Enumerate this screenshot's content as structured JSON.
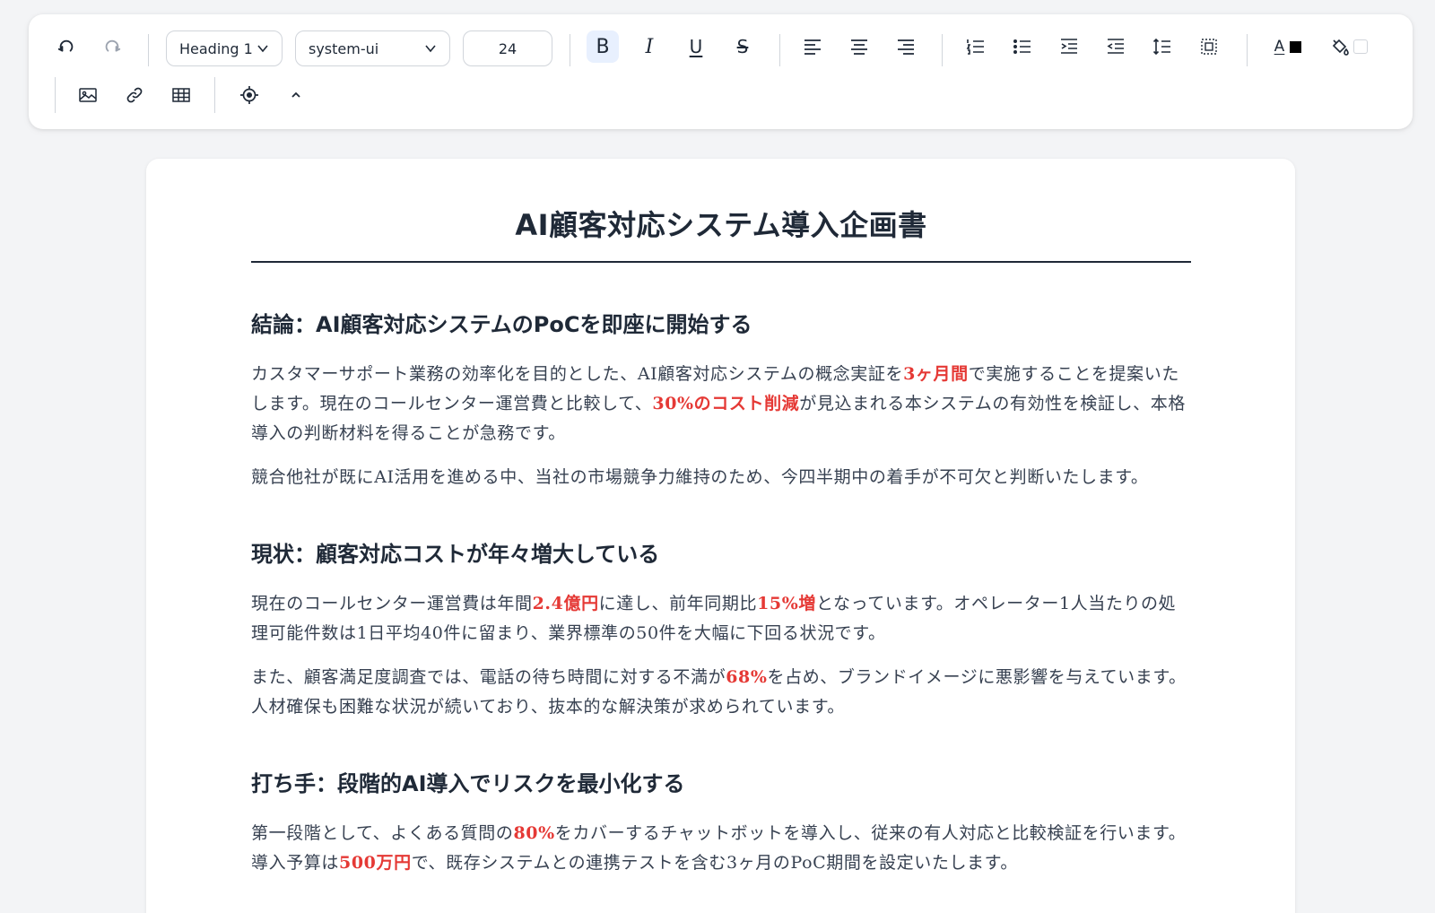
{
  "toolbar": {
    "block_style": "Heading 1",
    "font_family": "system-ui",
    "font_size": "24",
    "bold": "B",
    "italic": "I",
    "underline": "U",
    "strikethrough": "S",
    "font_color_letter": "A",
    "font_color": "#000000",
    "highlight_color": "#ffffff",
    "icons": [
      "undo-icon",
      "redo-icon",
      "align-left-icon",
      "align-center-icon",
      "align-right-icon",
      "ordered-list-icon",
      "bullet-list-icon",
      "indent-icon",
      "outdent-icon",
      "line-height-icon",
      "select-all-icon",
      "paint-bucket-icon",
      "image-icon",
      "link-icon",
      "table-icon",
      "target-icon",
      "chevron-up-icon"
    ]
  },
  "colors": {
    "accent": "#e53935",
    "active_bg": "#e8f0fe"
  },
  "document": {
    "title": "AI顧客対応システム導入企画書",
    "sections": [
      {
        "heading": "結論：AI顧客対応システムのPoCを即座に開始する",
        "paragraphs": [
          [
            {
              "t": "カスタマーサポート業務の効率化を目的とした、AI顧客対応システムの概念実証を"
            },
            {
              "t": "3ヶ月間",
              "hl": true
            },
            {
              "t": "で実施することを提案いたします。現在のコールセンター運営費と比較して、"
            },
            {
              "t": "30%のコスト削減",
              "hl": true
            },
            {
              "t": "が見込まれる本システムの有効性を検証し、本格導入の判断材料を得ることが急務です。"
            }
          ],
          [
            {
              "t": "競合他社が既にAI活用を進める中、当社の市場競争力維持のため、今四半期中の着手が不可欠と判断いたします。"
            }
          ]
        ]
      },
      {
        "heading": "現状：顧客対応コストが年々増大している",
        "paragraphs": [
          [
            {
              "t": "現在のコールセンター運営費は年間"
            },
            {
              "t": "2.4億円",
              "hl": true
            },
            {
              "t": "に達し、前年同期比"
            },
            {
              "t": "15%増",
              "hl": true
            },
            {
              "t": "となっています。オペレーター1人当たりの処理可能件数は1日平均40件に留まり、業界標準の50件を大幅に下回る状況です。"
            }
          ],
          [
            {
              "t": "また、顧客満足度調査では、電話の待ち時間に対する不満が"
            },
            {
              "t": "68%",
              "hl": true
            },
            {
              "t": "を占め、ブランドイメージに悪影響を与えています。人材確保も困難な状況が続いており、抜本的な解決策が求められています。"
            }
          ]
        ]
      },
      {
        "heading": "打ち手：段階的AI導入でリスクを最小化する",
        "paragraphs": [
          [
            {
              "t": "第一段階として、よくある質問の"
            },
            {
              "t": "80%",
              "hl": true
            },
            {
              "t": "をカバーするチャットボットを導入し、従来の有人対応と比較検証を行います。導入予算は"
            },
            {
              "t": "500万円",
              "hl": true
            },
            {
              "t": "で、既存システムとの連携テストを含む3ヶ月のPoC期間を設定いたします。"
            }
          ]
        ]
      }
    ]
  }
}
